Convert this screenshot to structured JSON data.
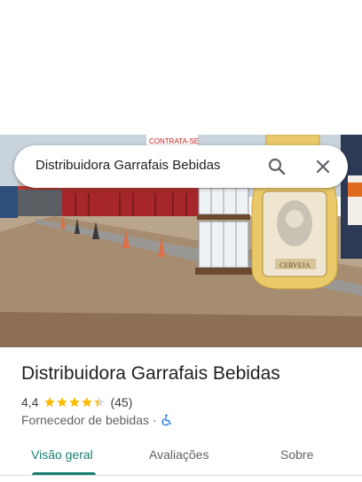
{
  "search": {
    "query": "Distribuidora Garrafais Bebidas",
    "search_icon": "search-icon",
    "close_icon": "close-icon"
  },
  "photo": {
    "sign_text": "CONTRATA-SE",
    "bottle_label": "CERVEJA"
  },
  "place": {
    "name": "Distribuidora Garrafais Bebidas",
    "rating": "4,4",
    "rating_value": 4.4,
    "stars_max": 5,
    "review_count": "(45)",
    "category": "Fornecedor de bebidas",
    "separator": "·",
    "accessibility_icon": "wheelchair-icon",
    "star_color": "#fbbc04",
    "accent_color": "#1a7f70"
  },
  "tabs": [
    {
      "label": "Visão geral",
      "active": true
    },
    {
      "label": "Avaliações",
      "active": false
    },
    {
      "label": "Sobre",
      "active": false
    }
  ]
}
